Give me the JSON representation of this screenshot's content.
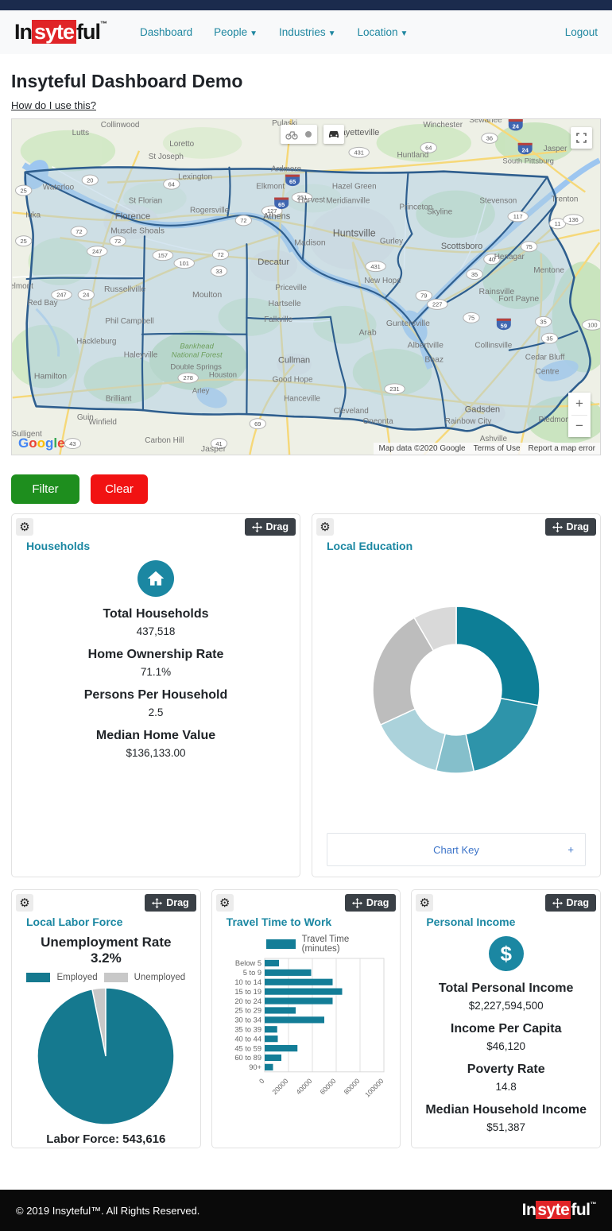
{
  "ui": {
    "drag": "Drag"
  },
  "navbar": {
    "brand": {
      "prefix": "In",
      "highlight": "syte",
      "suffix": "ful",
      "tm": "™"
    },
    "links": [
      {
        "label": "Dashboard",
        "dropdown": false
      },
      {
        "label": "People",
        "dropdown": true
      },
      {
        "label": "Industries",
        "dropdown": true
      },
      {
        "label": "Location",
        "dropdown": true
      }
    ],
    "logout": "Logout"
  },
  "page": {
    "title": "Insyteful Dashboard Demo",
    "help_link": "How do I use this?"
  },
  "map": {
    "google_logo": [
      "G",
      "o",
      "o",
      "g",
      "l",
      "e"
    ],
    "logo_colors": [
      "#4285F4",
      "#EA4335",
      "#FBBC05",
      "#4285F4",
      "#34A853",
      "#EA4335"
    ],
    "attribution": "Map data ©2020 Google",
    "terms_of_use": "Terms of Use",
    "report_error": "Report a map error",
    "zoom_in": "+",
    "zoom_out": "−",
    "forest_label": [
      "Bankhead",
      "National Forest"
    ],
    "towns": [
      [
        "Lutts",
        86,
        20,
        10
      ],
      [
        "Collinwood",
        136,
        10,
        10
      ],
      [
        "Loretto",
        214,
        34,
        10
      ],
      [
        "St Joseph",
        194,
        50,
        10
      ],
      [
        "Pulaski",
        344,
        8,
        10
      ],
      [
        "Fayetteville",
        436,
        20,
        11
      ],
      [
        "Winchester",
        544,
        10,
        10
      ],
      [
        "Sewanee",
        598,
        4,
        10
      ],
      [
        "Huntland",
        506,
        48,
        10
      ],
      [
        "Jasper",
        686,
        40,
        10
      ],
      [
        "South Pittsburg",
        652,
        56,
        9.5
      ],
      [
        "Waterloo",
        58,
        89,
        10
      ],
      [
        "Iuka",
        26,
        124,
        10
      ],
      [
        "Lexington",
        231,
        76,
        10
      ],
      [
        "St Florian",
        168,
        106,
        10
      ],
      [
        "Florence",
        152,
        126,
        11.5
      ],
      [
        "Muscle Shoals",
        158,
        144,
        10.5
      ],
      [
        "Rogersville",
        249,
        118,
        10
      ],
      [
        "Elkmont",
        326,
        88,
        10
      ],
      [
        "Athens",
        334,
        126,
        11
      ],
      [
        "Ardmore",
        346,
        66,
        10
      ],
      [
        "Madison",
        376,
        159,
        10.5
      ],
      [
        "Huntsville",
        432,
        148,
        12.5
      ],
      [
        "Hazel Green",
        432,
        88,
        10
      ],
      [
        "Meridianville",
        424,
        106,
        10
      ],
      [
        "Harvest",
        378,
        105,
        10
      ],
      [
        "Princeton",
        510,
        114,
        10
      ],
      [
        "Skyline",
        540,
        120,
        10
      ],
      [
        "Stevenson",
        614,
        106,
        10
      ],
      [
        "Trenton",
        698,
        104,
        10
      ],
      [
        "Scottsboro",
        568,
        164,
        11
      ],
      [
        "Henagar",
        628,
        177,
        10
      ],
      [
        "Mentone",
        678,
        194,
        10
      ],
      [
        "Decatur",
        330,
        184,
        11.5
      ],
      [
        "Priceville",
        352,
        216,
        10
      ],
      [
        "Hartselle",
        344,
        236,
        10.5
      ],
      [
        "Falkville",
        336,
        256,
        10
      ],
      [
        "Moulton",
        246,
        225,
        10.5
      ],
      [
        "Russellville",
        142,
        218,
        10.5
      ],
      [
        "Red Bay",
        38,
        235,
        10
      ],
      [
        "Belmont",
        8,
        214,
        10
      ],
      [
        "Phil Campbell",
        148,
        258,
        10
      ],
      [
        "Hackleburg",
        106,
        284,
        10
      ],
      [
        "Haleyville",
        162,
        301,
        10
      ],
      [
        "Hamilton",
        48,
        328,
        10.5
      ],
      [
        "Brilliant",
        134,
        356,
        10
      ],
      [
        "Guin",
        92,
        380,
        10
      ],
      [
        "Winfield",
        114,
        386,
        10
      ],
      [
        "Sulligent",
        18,
        401,
        10
      ],
      [
        "Carbon Hill",
        192,
        409,
        10
      ],
      [
        "Jasper",
        254,
        420,
        10.5
      ],
      [
        "Double Springs",
        232,
        316,
        9.5
      ],
      [
        "Houston",
        266,
        326,
        9.5
      ],
      [
        "Arley",
        238,
        346,
        9.5
      ],
      [
        "Cullman",
        356,
        308,
        11
      ],
      [
        "Good Hope",
        354,
        332,
        10
      ],
      [
        "Hanceville",
        366,
        356,
        10
      ],
      [
        "Arab",
        449,
        273,
        10.5
      ],
      [
        "Albertville",
        522,
        289,
        10.5
      ],
      [
        "Boaz",
        533,
        307,
        10.5
      ],
      [
        "Guntersville",
        500,
        261,
        10.5
      ],
      [
        "New Hope",
        468,
        207,
        10
      ],
      [
        "Gurley",
        479,
        157,
        10
      ],
      [
        "Cleveland",
        428,
        372,
        10
      ],
      [
        "Oneonta",
        462,
        385,
        10
      ],
      [
        "Gadsden",
        594,
        370,
        11
      ],
      [
        "Rainbow City",
        576,
        385,
        10
      ],
      [
        "Ashville",
        608,
        407,
        10
      ],
      [
        "Piedmont",
        686,
        383,
        10
      ],
      [
        "Cedar Bluff",
        673,
        304,
        10
      ],
      [
        "Centre",
        676,
        322,
        10
      ],
      [
        "Collinsville",
        608,
        289,
        10
      ],
      [
        "Fort Payne",
        640,
        230,
        10.5
      ],
      [
        "Rainsville",
        612,
        221,
        10.5
      ]
    ],
    "shields": [
      [
        "25",
        14,
        90,
        "o"
      ],
      [
        "20",
        98,
        77,
        "o"
      ],
      [
        "64",
        201,
        82,
        "o"
      ],
      [
        "431",
        438,
        42,
        "o"
      ],
      [
        "64",
        526,
        36,
        "o"
      ],
      [
        "36",
        603,
        24,
        "o"
      ],
      [
        "25",
        14,
        154,
        "o"
      ],
      [
        "72",
        84,
        142,
        "o"
      ],
      [
        "247",
        107,
        167,
        "o"
      ],
      [
        "72",
        133,
        154,
        "o"
      ],
      [
        "157",
        190,
        172,
        "o"
      ],
      [
        "101",
        217,
        182,
        "o"
      ],
      [
        "72",
        263,
        171,
        "o"
      ],
      [
        "33",
        261,
        192,
        "o"
      ],
      [
        "247",
        62,
        222,
        "o"
      ],
      [
        "24",
        93,
        222,
        "o"
      ],
      [
        "251",
        366,
        99,
        "o"
      ],
      [
        "127",
        328,
        116,
        "o"
      ],
      [
        "72",
        292,
        128,
        "o"
      ],
      [
        "431",
        459,
        186,
        "o"
      ],
      [
        "79",
        520,
        223,
        "o"
      ],
      [
        "227",
        537,
        234,
        "o"
      ],
      [
        "35",
        584,
        196,
        "o"
      ],
      [
        "40",
        606,
        177,
        "o"
      ],
      [
        "75",
        653,
        161,
        "o"
      ],
      [
        "117",
        639,
        123,
        "o"
      ],
      [
        "75",
        580,
        251,
        "o"
      ],
      [
        "35",
        671,
        256,
        "o"
      ],
      [
        "35",
        679,
        277,
        "o"
      ],
      [
        "100",
        733,
        260,
        "o"
      ],
      [
        "11",
        689,
        132,
        "o"
      ],
      [
        "136",
        709,
        127,
        "o"
      ],
      [
        "231",
        483,
        341,
        "o"
      ],
      [
        "278",
        222,
        327,
        "o"
      ],
      [
        "69",
        310,
        385,
        "o"
      ],
      [
        "41",
        261,
        410,
        "o"
      ],
      [
        "43",
        76,
        410,
        "o"
      ],
      [
        "65",
        354,
        77,
        "i"
      ],
      [
        "65",
        340,
        106,
        "i"
      ],
      [
        "24",
        636,
        7,
        "i"
      ],
      [
        "24",
        648,
        37,
        "i"
      ],
      [
        "59",
        621,
        259,
        "i"
      ]
    ]
  },
  "filters": {
    "filter_label": "Filter",
    "clear_label": "Clear"
  },
  "cards": {
    "households": {
      "title": "Households",
      "icon": "house-icon",
      "stats": [
        {
          "label": "Total Households",
          "value": "437,518"
        },
        {
          "label": "Home Ownership Rate",
          "value": "71.1%"
        },
        {
          "label": "Persons Per Household",
          "value": "2.5"
        },
        {
          "label": "Median Home Value",
          "value": "$136,133.00"
        }
      ]
    },
    "education": {
      "title": "Local Education",
      "chart_key_label": "Chart Key",
      "expand_symbol": "+"
    },
    "labor": {
      "title": "Local Labor Force",
      "headline": "Unemployment Rate 3.2%",
      "legend": [
        "Employed",
        "Unemployed"
      ],
      "footer_label": "Labor Force: 543,616"
    },
    "travel": {
      "title": "Travel Time to Work",
      "legend_label": "Travel Time (minutes)"
    },
    "income": {
      "title": "Personal Income",
      "icon": "dollar-icon",
      "stats": [
        {
          "label": "Total Personal Income",
          "value": "$2,227,594,500"
        },
        {
          "label": "Income Per Capita",
          "value": "$46,120"
        },
        {
          "label": "Poverty Rate",
          "value": "14.8"
        },
        {
          "label": "Median Household Income",
          "value": "$51,387"
        }
      ]
    }
  },
  "chart_data": [
    {
      "id": "education_donut",
      "type": "pie",
      "style": "donut",
      "title": "Local Education",
      "start_angle": 0,
      "slices": [
        {
          "value": 28.0,
          "color": "#0d7e96"
        },
        {
          "value": 18.6,
          "color": "#2e94aa"
        },
        {
          "value": 7.3,
          "color": "#85bfcb"
        },
        {
          "value": 14.2,
          "color": "#abd2db"
        },
        {
          "value": 23.5,
          "color": "#bdbdbd"
        },
        {
          "value": 8.4,
          "color": "#d9d9d9"
        }
      ],
      "legend_position": "collapsed (Chart Key)"
    },
    {
      "id": "labor_pie",
      "type": "pie",
      "title": "Local Labor Force",
      "start_angle": -11.5,
      "slices": [
        {
          "label": "Unemployed",
          "value": 3.2,
          "color": "#c8c8c8"
        },
        {
          "label": "Employed",
          "value": 96.8,
          "color": "#15798f"
        }
      ]
    },
    {
      "id": "travel_bars",
      "type": "bar",
      "orientation": "horizontal",
      "legend": "Travel Time (minutes)",
      "categories": [
        "Below 5",
        "5 to 9",
        "10 to 14",
        "15 to 19",
        "20 to 24",
        "25 to 29",
        "30 to 34",
        "35 to 39",
        "40 to 44",
        "45 to 59",
        "60 to 89",
        "90+"
      ],
      "values": [
        12000,
        39000,
        57000,
        65000,
        57000,
        26000,
        50000,
        10500,
        11000,
        27500,
        14000,
        7000
      ],
      "xticks": [
        0,
        20000,
        40000,
        60000,
        80000,
        100000
      ],
      "xlim": [
        0,
        100000
      ],
      "bar_color": "#137d97",
      "grid": true
    }
  ],
  "footer": {
    "copyright": "© 2019 Insyteful™. All Rights Reserved."
  },
  "colors": {
    "accent_teal": "#1b87a2",
    "navy": "#1b2b4d",
    "logo_red": "#e02427",
    "filter_green": "#1e8e1e",
    "clear_red": "#f11212",
    "region_fill": "#aecde4",
    "region_border": "#2e5e8e"
  }
}
